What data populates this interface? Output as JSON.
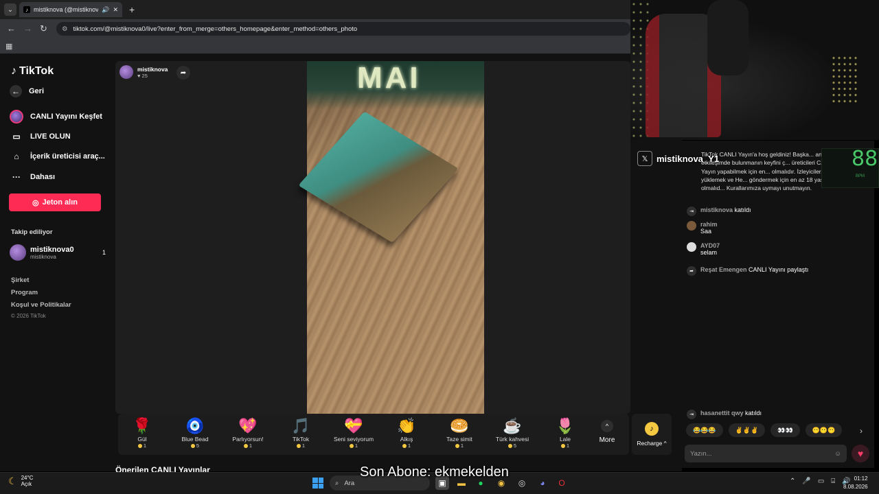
{
  "browser": {
    "tab_title": "mistiknova (@mistiknova0) ...",
    "url": "tiktok.com/@mistiknova0/live?enter_from_merge=others_homepage&enter_method=others_photo"
  },
  "sidebar": {
    "logo": "TikTok",
    "items": [
      {
        "label": "Geri"
      },
      {
        "label": "CANLI Yayını Keşfet"
      },
      {
        "label": "LIVE OLUN"
      },
      {
        "label": "İçerik üreticisi araç..."
      },
      {
        "label": "Dahası"
      }
    ],
    "coin_button": "Jeton alın",
    "following_header": "Takip ediliyor",
    "following": [
      {
        "name": "mistiknova0",
        "handle": "mistiknova",
        "count": "1"
      }
    ],
    "footer_links": [
      "Şirket",
      "Program",
      "Koşul ve Politikalar"
    ],
    "copyright": "© 2026 TikTok"
  },
  "stream": {
    "streamer_name": "mistiknova",
    "likes": "25",
    "neon_text": "MAI",
    "overlay_name": "mistiknova_Y1",
    "bpm": "88",
    "bpm_unit": "BPM"
  },
  "gifts": [
    {
      "name": "Gül",
      "price": "1",
      "emoji": "🌹"
    },
    {
      "name": "Blue Bead",
      "price": "5",
      "emoji": "🧿"
    },
    {
      "name": "Parlıyorsun!",
      "price": "1",
      "emoji": "💖"
    },
    {
      "name": "TikTok",
      "price": "1",
      "emoji": "🎵"
    },
    {
      "name": "Seni seviyorum",
      "price": "1",
      "emoji": "💝"
    },
    {
      "name": "Alkış",
      "price": "1",
      "emoji": "👏"
    },
    {
      "name": "Taze simit",
      "price": "1",
      "emoji": "🥯"
    },
    {
      "name": "Türk kahvesi",
      "price": "5",
      "emoji": "☕"
    },
    {
      "name": "Lale",
      "price": "1",
      "emoji": "🌷"
    }
  ],
  "more_label": "More",
  "recharge_label": "Recharge ^",
  "suggested_heading": "Önerilen CANLI Yayınlar",
  "chat": {
    "welcome": "TikTok CANLI Yayın'a hoş geldiniz! Başka... anlı etkileşimde bulunmanın keyfini ç... üreticileri CANLI Yayın yapabilmek için en... olmalıdır. İzleyiciler, para yüklemek ve He... göndermek için en az 18 yaşında olmalıd... Kurallarımıza uymayı unutmayın.",
    "messages": [
      {
        "user": "mistiknova",
        "text": "katıldı",
        "icon": "join"
      },
      {
        "user": "rahim",
        "text": "Saa",
        "icon": "avatar"
      },
      {
        "user": "AYD07",
        "text": "selam",
        "icon": "avatar"
      },
      {
        "user": "Reşat Emengen",
        "text": "CANLI Yayını paylaştı",
        "icon": "share"
      }
    ],
    "bottom_message": {
      "user": "hasanettit qwy",
      "text": "katıldı"
    },
    "emoji_pills": [
      "😂😂😂",
      "✌✌✌",
      "👀👀",
      "😶😶😶"
    ],
    "input_placeholder": "Yazın..."
  },
  "stream_overlay_text": "Son Abone: ekmekelden",
  "taskbar": {
    "temp": "24°C",
    "weather": "Açık",
    "search_placeholder": "Ara",
    "time": "01:12",
    "date": "8.08.2026"
  }
}
